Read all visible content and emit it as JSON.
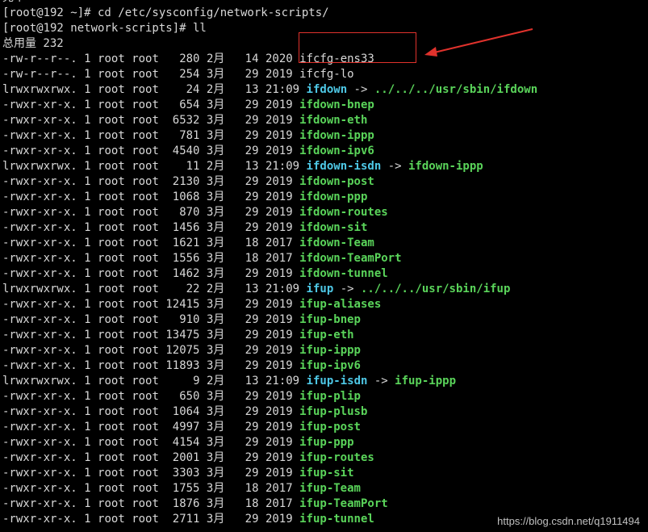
{
  "terminal": {
    "partial_top": "完牛",
    "prompt_1": "[root@192 ~]# cd /etc/sysconfig/network-scripts/",
    "prompt_2": "[root@192 network-scripts]# ll",
    "total": "总用量 232"
  },
  "entries": [
    {
      "perm": "-rw-r--r--.",
      "links": "1",
      "owner": "root",
      "group": "root",
      "size": "280",
      "month": "2月",
      "day": "14",
      "time": "2020",
      "name": "ifcfg-ens33",
      "kind": "plain"
    },
    {
      "perm": "-rw-r--r--.",
      "links": "1",
      "owner": "root",
      "group": "root",
      "size": "254",
      "month": "3月",
      "day": "29",
      "time": "2019",
      "name": "ifcfg-lo",
      "kind": "plain"
    },
    {
      "perm": "lrwxrwxrwx.",
      "links": "1",
      "owner": "root",
      "group": "root",
      "size": "24",
      "month": "2月",
      "day": "13",
      "time": "21:09",
      "name": "ifdown",
      "kind": "link",
      "target": "../../../usr/sbin/ifdown",
      "target_kind": "exec"
    },
    {
      "perm": "-rwxr-xr-x.",
      "links": "1",
      "owner": "root",
      "group": "root",
      "size": "654",
      "month": "3月",
      "day": "29",
      "time": "2019",
      "name": "ifdown-bnep",
      "kind": "exec"
    },
    {
      "perm": "-rwxr-xr-x.",
      "links": "1",
      "owner": "root",
      "group": "root",
      "size": "6532",
      "month": "3月",
      "day": "29",
      "time": "2019",
      "name": "ifdown-eth",
      "kind": "exec"
    },
    {
      "perm": "-rwxr-xr-x.",
      "links": "1",
      "owner": "root",
      "group": "root",
      "size": "781",
      "month": "3月",
      "day": "29",
      "time": "2019",
      "name": "ifdown-ippp",
      "kind": "exec"
    },
    {
      "perm": "-rwxr-xr-x.",
      "links": "1",
      "owner": "root",
      "group": "root",
      "size": "4540",
      "month": "3月",
      "day": "29",
      "time": "2019",
      "name": "ifdown-ipv6",
      "kind": "exec"
    },
    {
      "perm": "lrwxrwxrwx.",
      "links": "1",
      "owner": "root",
      "group": "root",
      "size": "11",
      "month": "2月",
      "day": "13",
      "time": "21:09",
      "name": "ifdown-isdn",
      "kind": "link",
      "target": "ifdown-ippp",
      "target_kind": "exec"
    },
    {
      "perm": "-rwxr-xr-x.",
      "links": "1",
      "owner": "root",
      "group": "root",
      "size": "2130",
      "month": "3月",
      "day": "29",
      "time": "2019",
      "name": "ifdown-post",
      "kind": "exec"
    },
    {
      "perm": "-rwxr-xr-x.",
      "links": "1",
      "owner": "root",
      "group": "root",
      "size": "1068",
      "month": "3月",
      "day": "29",
      "time": "2019",
      "name": "ifdown-ppp",
      "kind": "exec"
    },
    {
      "perm": "-rwxr-xr-x.",
      "links": "1",
      "owner": "root",
      "group": "root",
      "size": "870",
      "month": "3月",
      "day": "29",
      "time": "2019",
      "name": "ifdown-routes",
      "kind": "exec"
    },
    {
      "perm": "-rwxr-xr-x.",
      "links": "1",
      "owner": "root",
      "group": "root",
      "size": "1456",
      "month": "3月",
      "day": "29",
      "time": "2019",
      "name": "ifdown-sit",
      "kind": "exec"
    },
    {
      "perm": "-rwxr-xr-x.",
      "links": "1",
      "owner": "root",
      "group": "root",
      "size": "1621",
      "month": "3月",
      "day": "18",
      "time": "2017",
      "name": "ifdown-Team",
      "kind": "exec"
    },
    {
      "perm": "-rwxr-xr-x.",
      "links": "1",
      "owner": "root",
      "group": "root",
      "size": "1556",
      "month": "3月",
      "day": "18",
      "time": "2017",
      "name": "ifdown-TeamPort",
      "kind": "exec"
    },
    {
      "perm": "-rwxr-xr-x.",
      "links": "1",
      "owner": "root",
      "group": "root",
      "size": "1462",
      "month": "3月",
      "day": "29",
      "time": "2019",
      "name": "ifdown-tunnel",
      "kind": "exec"
    },
    {
      "perm": "lrwxrwxrwx.",
      "links": "1",
      "owner": "root",
      "group": "root",
      "size": "22",
      "month": "2月",
      "day": "13",
      "time": "21:09",
      "name": "ifup",
      "kind": "link",
      "target": "../../../usr/sbin/ifup",
      "target_kind": "exec"
    },
    {
      "perm": "-rwxr-xr-x.",
      "links": "1",
      "owner": "root",
      "group": "root",
      "size": "12415",
      "month": "3月",
      "day": "29",
      "time": "2019",
      "name": "ifup-aliases",
      "kind": "exec"
    },
    {
      "perm": "-rwxr-xr-x.",
      "links": "1",
      "owner": "root",
      "group": "root",
      "size": "910",
      "month": "3月",
      "day": "29",
      "time": "2019",
      "name": "ifup-bnep",
      "kind": "exec"
    },
    {
      "perm": "-rwxr-xr-x.",
      "links": "1",
      "owner": "root",
      "group": "root",
      "size": "13475",
      "month": "3月",
      "day": "29",
      "time": "2019",
      "name": "ifup-eth",
      "kind": "exec"
    },
    {
      "perm": "-rwxr-xr-x.",
      "links": "1",
      "owner": "root",
      "group": "root",
      "size": "12075",
      "month": "3月",
      "day": "29",
      "time": "2019",
      "name": "ifup-ippp",
      "kind": "exec"
    },
    {
      "perm": "-rwxr-xr-x.",
      "links": "1",
      "owner": "root",
      "group": "root",
      "size": "11893",
      "month": "3月",
      "day": "29",
      "time": "2019",
      "name": "ifup-ipv6",
      "kind": "exec"
    },
    {
      "perm": "lrwxrwxrwx.",
      "links": "1",
      "owner": "root",
      "group": "root",
      "size": "9",
      "month": "2月",
      "day": "13",
      "time": "21:09",
      "name": "ifup-isdn",
      "kind": "link",
      "target": "ifup-ippp",
      "target_kind": "exec"
    },
    {
      "perm": "-rwxr-xr-x.",
      "links": "1",
      "owner": "root",
      "group": "root",
      "size": "650",
      "month": "3月",
      "day": "29",
      "time": "2019",
      "name": "ifup-plip",
      "kind": "exec"
    },
    {
      "perm": "-rwxr-xr-x.",
      "links": "1",
      "owner": "root",
      "group": "root",
      "size": "1064",
      "month": "3月",
      "day": "29",
      "time": "2019",
      "name": "ifup-plusb",
      "kind": "exec"
    },
    {
      "perm": "-rwxr-xr-x.",
      "links": "1",
      "owner": "root",
      "group": "root",
      "size": "4997",
      "month": "3月",
      "day": "29",
      "time": "2019",
      "name": "ifup-post",
      "kind": "exec"
    },
    {
      "perm": "-rwxr-xr-x.",
      "links": "1",
      "owner": "root",
      "group": "root",
      "size": "4154",
      "month": "3月",
      "day": "29",
      "time": "2019",
      "name": "ifup-ppp",
      "kind": "exec"
    },
    {
      "perm": "-rwxr-xr-x.",
      "links": "1",
      "owner": "root",
      "group": "root",
      "size": "2001",
      "month": "3月",
      "day": "29",
      "time": "2019",
      "name": "ifup-routes",
      "kind": "exec"
    },
    {
      "perm": "-rwxr-xr-x.",
      "links": "1",
      "owner": "root",
      "group": "root",
      "size": "3303",
      "month": "3月",
      "day": "29",
      "time": "2019",
      "name": "ifup-sit",
      "kind": "exec"
    },
    {
      "perm": "-rwxr-xr-x.",
      "links": "1",
      "owner": "root",
      "group": "root",
      "size": "1755",
      "month": "3月",
      "day": "18",
      "time": "2017",
      "name": "ifup-Team",
      "kind": "exec"
    },
    {
      "perm": "-rwxr-xr-x.",
      "links": "1",
      "owner": "root",
      "group": "root",
      "size": "1876",
      "month": "3月",
      "day": "18",
      "time": "2017",
      "name": "ifup-TeamPort",
      "kind": "exec"
    },
    {
      "perm": "-rwxr-xr-x.",
      "links": "1",
      "owner": "root",
      "group": "root",
      "size": "2711",
      "month": "3月",
      "day": "29",
      "time": "2019",
      "name": "ifup-tunnel",
      "kind": "exec"
    }
  ],
  "annotation": {
    "color": "#e0322c",
    "arrow_icon": "arrow-left-icon"
  },
  "colors": {
    "background": "#000000",
    "text": "#d8d8d8",
    "exec": "#5ad45a",
    "link": "#4ec8e6"
  },
  "watermark": "https://blog.csdn.net/q1911494"
}
